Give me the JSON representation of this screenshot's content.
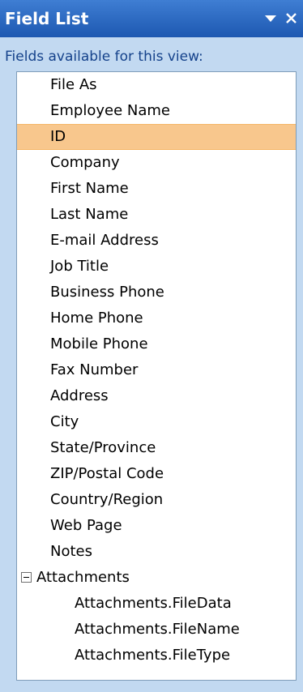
{
  "panel": {
    "title": "Field List",
    "subtitle": "Fields available for this view:",
    "menu_icon": "dropdown-arrow-icon",
    "close_icon": "close-icon"
  },
  "fields": [
    "File As",
    "Employee Name",
    "ID",
    "Company",
    "First Name",
    "Last Name",
    "E-mail Address",
    "Job Title",
    "Business Phone",
    "Home Phone",
    "Mobile Phone",
    "Fax Number",
    "Address",
    "City",
    "State/Province",
    "ZIP/Postal Code",
    "Country/Region",
    "Web Page",
    "Notes"
  ],
  "selected_field": "ID",
  "attachments": {
    "label": "Attachments",
    "expanded": true,
    "children": [
      "Attachments.FileData",
      "Attachments.FileName",
      "Attachments.FileType"
    ]
  },
  "colors": {
    "title_bar": "#1d58b1",
    "pane_bg": "#c2d9f1",
    "selection": "#f8c78d",
    "subtitle_text": "#15428b"
  }
}
